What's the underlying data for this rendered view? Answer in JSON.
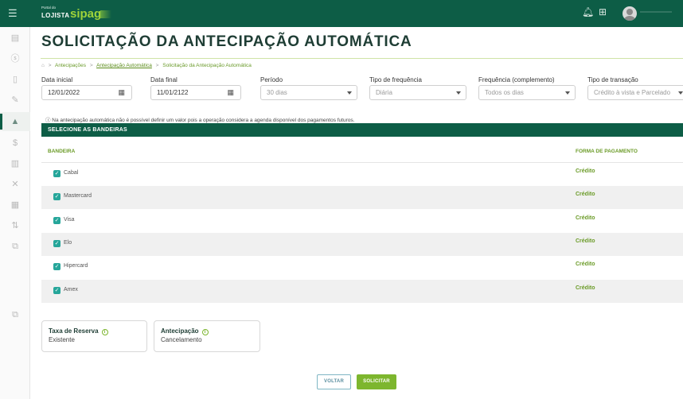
{
  "topbar": {
    "brand_small": "Portal do",
    "brand_lojista": "LOJISTA",
    "brand_sipag": "sipag",
    "bell_icon": "bell-icon",
    "grid_icon": "grid-icon",
    "avatar_icon": "user-avatar"
  },
  "page": {
    "title": "SOLICITAÇÃO DA ANTECIPAÇÃO AUTOMÁTICA",
    "breadcrumb": {
      "home_icon": "home-icon",
      "sep": ">",
      "item1": "Antecipações",
      "item2": "Antecipação Automática",
      "item3": "Solicitação da Antecipação Automática"
    }
  },
  "filters": {
    "data_inicial": {
      "label": "Data inicial",
      "value": "12/01/2022"
    },
    "data_final": {
      "label": "Data final",
      "value": "11/01/2122"
    },
    "periodo": {
      "label": "Período",
      "value": "30 dias"
    },
    "tipo_frequencia": {
      "label": "Tipo de frequência",
      "value": "Diária"
    },
    "frequencia_complemento": {
      "label": "Frequência (complemento)",
      "value": "Todos os dias"
    },
    "tipo_transacao": {
      "label": "Tipo de transação",
      "value": "Crédito à vista e Parcelado"
    }
  },
  "info_text": "ⓘ Na antecipação automática não é possível definir um valor pois a operação considera a agenda disponível dos pagamentos futuros.",
  "bandeiras": {
    "section_title": "SELECIONE AS BANDEIRAS",
    "col_bandeira": "BANDEIRA",
    "col_forma": "FORMA DE PAGAMENTO",
    "rows": [
      {
        "name": "Cabal",
        "checked": true,
        "forma": "Crédito"
      },
      {
        "name": "Mastercard",
        "checked": true,
        "forma": "Crédito"
      },
      {
        "name": "Visa",
        "checked": true,
        "forma": "Crédito"
      },
      {
        "name": "Elo",
        "checked": true,
        "forma": "Crédito"
      },
      {
        "name": "Hipercard",
        "checked": true,
        "forma": "Crédito"
      },
      {
        "name": "Amex",
        "checked": true,
        "forma": "Crédito"
      }
    ]
  },
  "cards": {
    "taxa": {
      "title": "Taxa de Reserva",
      "value": "Existente"
    },
    "antecipacao": {
      "title": "Antecipação",
      "value": "Cancelamento"
    }
  },
  "actions": {
    "voltar": "VOLTAR",
    "solicitar": "SOLICITAR"
  },
  "colors": {
    "primary": "#0d5d46",
    "accent_green": "#7db62e",
    "checkbox": "#26a69a"
  }
}
